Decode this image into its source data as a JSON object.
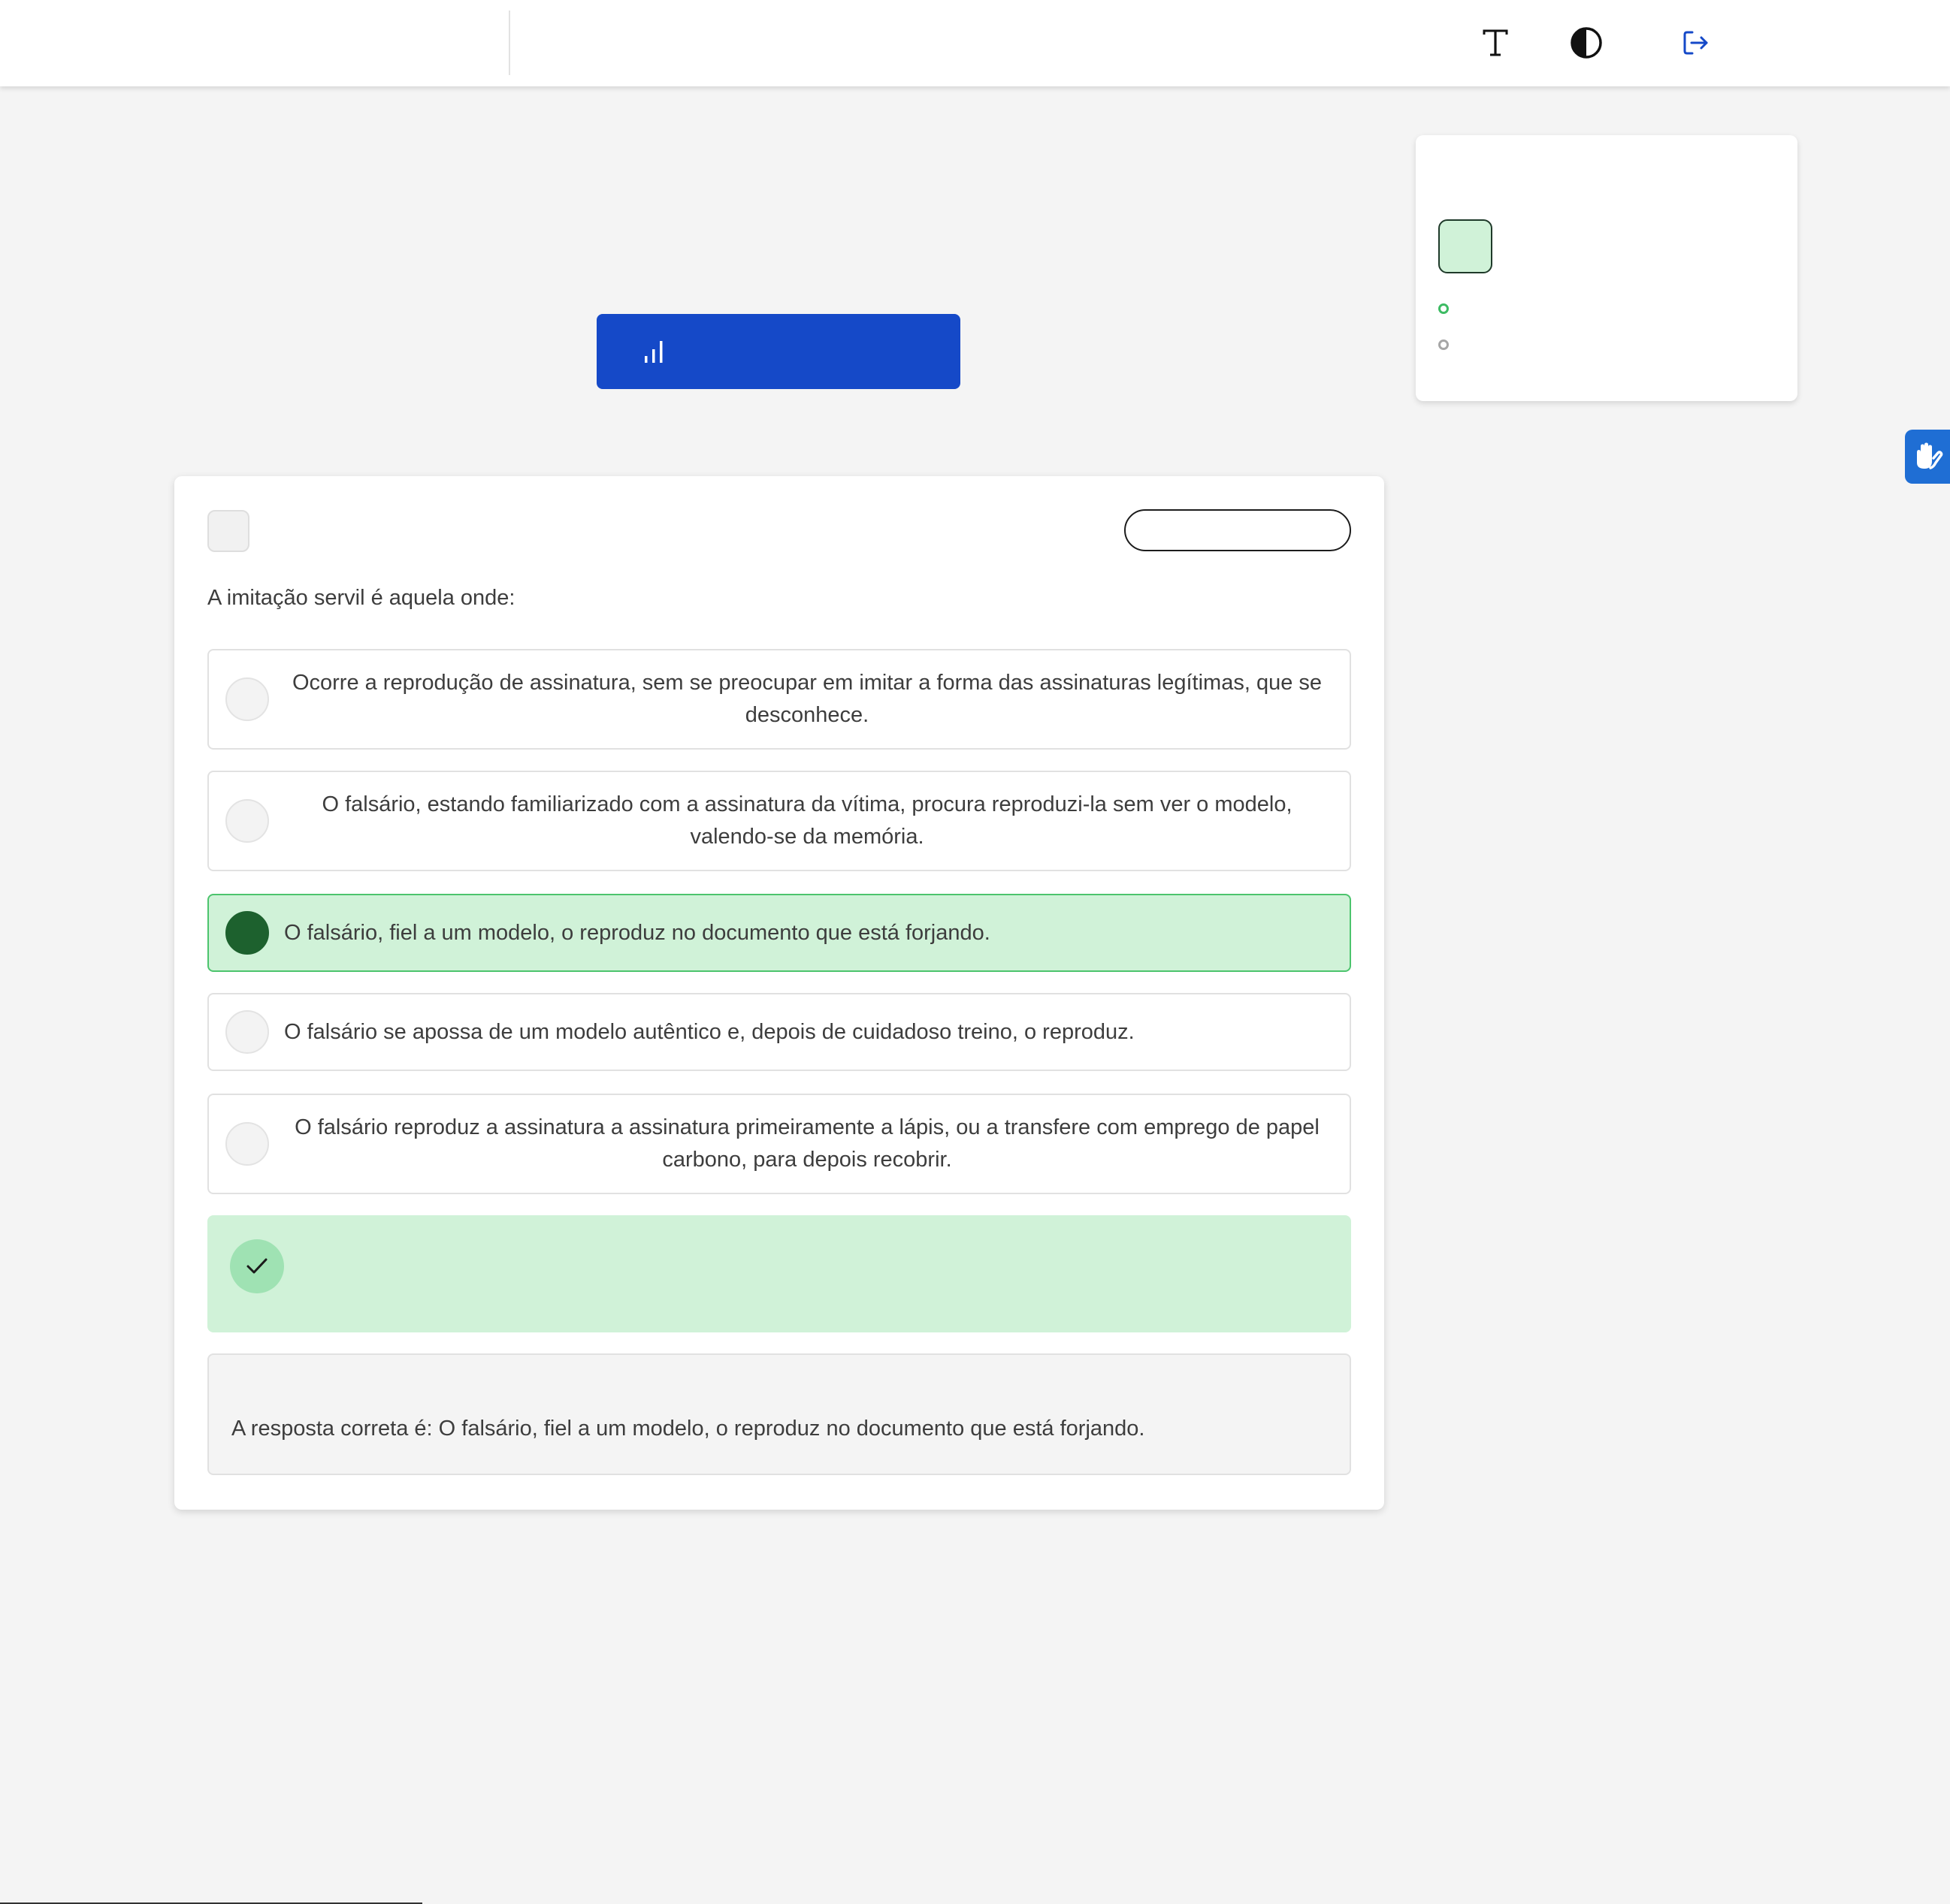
{
  "topbar": {
    "icons": {
      "font_size": "text-size-icon",
      "contrast": "contrast-icon",
      "logout": "logout-icon"
    }
  },
  "stats_button": {
    "icon": "bar-chart-icon"
  },
  "question": {
    "text": "A imitação servil é aquela onde:",
    "options": [
      {
        "text": "Ocorre a reprodução de assinatura, sem se preocupar em imitar a forma das assinaturas legítimas, que se desconhece.",
        "selected": false
      },
      {
        "text": "O falsário, estando familiarizado com a assinatura da vítima, procura reproduzi-la sem ver o modelo, valendo-se da memória.",
        "selected": false
      },
      {
        "text": "O falsário, fiel a um modelo, o reproduz no documento que está forjando.",
        "selected": true
      },
      {
        "text": "O falsário se apossa de um modelo autêntico e, depois de cuidadoso treino, o reproduz.",
        "selected": false
      },
      {
        "text": "O falsário reproduz a assinatura a assinatura primeiramente a lápis, ou a transfere com emprego de papel carbono, para depois recobrir.",
        "selected": false
      }
    ],
    "answer_text": "A resposta correta é: O falsário, fiel a um modelo, o reproduz no documento que está forjando."
  },
  "colors": {
    "primary_blue": "#1549c8",
    "correct_bg": "#d0f2d8",
    "selected_radio": "#1d612e",
    "correct_border": "#4cc46d",
    "check_circle": "#9fe2b3",
    "a11y_blue": "#1f6ed4"
  }
}
